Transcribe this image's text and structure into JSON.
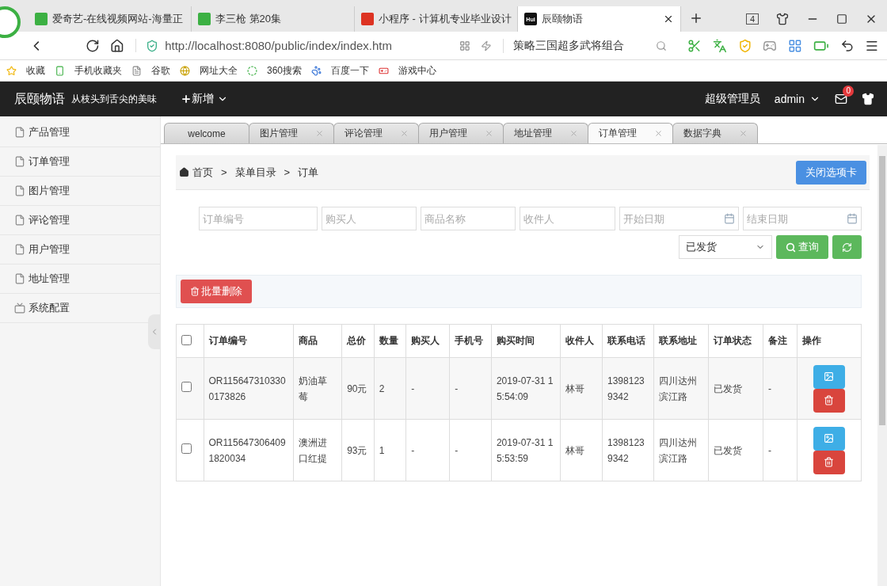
{
  "browser": {
    "tabs": [
      {
        "title": "爱奇艺-在线视频网站-海量正",
        "selected": false
      },
      {
        "title": "李三枪 第20集",
        "selected": false
      },
      {
        "title": "小程序 - 计算机专业毕业设计",
        "selected": false
      },
      {
        "title": "辰颐物语",
        "selected": true,
        "icon_text": "Hui"
      }
    ],
    "window_count": "4",
    "url": "http://localhost:8080/public/index/index.htm",
    "search_text": "策略三国超多武将组合",
    "bookmarks": [
      "收藏",
      "手机收藏夹",
      "谷歌",
      "网址大全",
      "360搜索",
      "百度一下",
      "游戏中心"
    ]
  },
  "header": {
    "brand": "辰颐物语",
    "slogan": "从枝头到舌尖的美味",
    "add_menu": "新增",
    "role": "超级管理员",
    "user": "admin",
    "mail_badge": "0"
  },
  "sidebar": {
    "items": [
      {
        "label": "产品管理",
        "kind": "page"
      },
      {
        "label": "订单管理",
        "kind": "page"
      },
      {
        "label": "图片管理",
        "kind": "page"
      },
      {
        "label": "评论管理",
        "kind": "page"
      },
      {
        "label": "用户管理",
        "kind": "page"
      },
      {
        "label": "地址管理",
        "kind": "page"
      },
      {
        "label": "系统配置",
        "kind": "config"
      }
    ]
  },
  "tabs": [
    {
      "label": "welcome",
      "selected": false,
      "closable": false
    },
    {
      "label": "图片管理",
      "selected": false,
      "closable": true
    },
    {
      "label": "评论管理",
      "selected": false,
      "closable": true
    },
    {
      "label": "用户管理",
      "selected": false,
      "closable": true
    },
    {
      "label": "地址管理",
      "selected": false,
      "closable": true
    },
    {
      "label": "订单管理",
      "selected": true,
      "closable": true
    },
    {
      "label": "数据字典",
      "selected": false,
      "closable": true
    }
  ],
  "breadcrumb": {
    "items": [
      "首页",
      "菜单目录",
      "订单"
    ],
    "separator": ">"
  },
  "close_tab_button": "关闭选项卡",
  "filters": [
    {
      "placeholder": "订单编号",
      "kind": "text"
    },
    {
      "placeholder": "购买人",
      "kind": "text"
    },
    {
      "placeholder": "商品名称",
      "kind": "text"
    },
    {
      "placeholder": "收件人",
      "kind": "text"
    },
    {
      "placeholder": "开始日期",
      "kind": "date"
    },
    {
      "placeholder": "结束日期",
      "kind": "date"
    }
  ],
  "status_select": "已发货",
  "query_button": "查询",
  "batch_delete_button": "批量删除",
  "table": {
    "all_checked": false,
    "columns": [
      "订单编号",
      "商品",
      "总价",
      "数量",
      "购买人",
      "手机号",
      "购买时间",
      "收件人",
      "联系电话",
      "联系地址",
      "订单状态",
      "备注",
      "操作"
    ],
    "rows": [
      {
        "checked": false,
        "cells": [
          "OR1156473103300173826",
          "奶油草莓",
          "90元",
          "2",
          "-",
          "-",
          "2019-07-31 15:54:09",
          "林哥",
          "13981239342",
          "四川达州滨江路",
          "已发货",
          "-"
        ]
      },
      {
        "checked": false,
        "cells": [
          "OR1156473064091820034",
          "澳洲进口红提",
          "93元",
          "1",
          "-",
          "-",
          "2019-07-31 15:53:59",
          "林哥",
          "13981239342",
          "四川达州滨江路",
          "已发货",
          "-"
        ]
      }
    ]
  }
}
